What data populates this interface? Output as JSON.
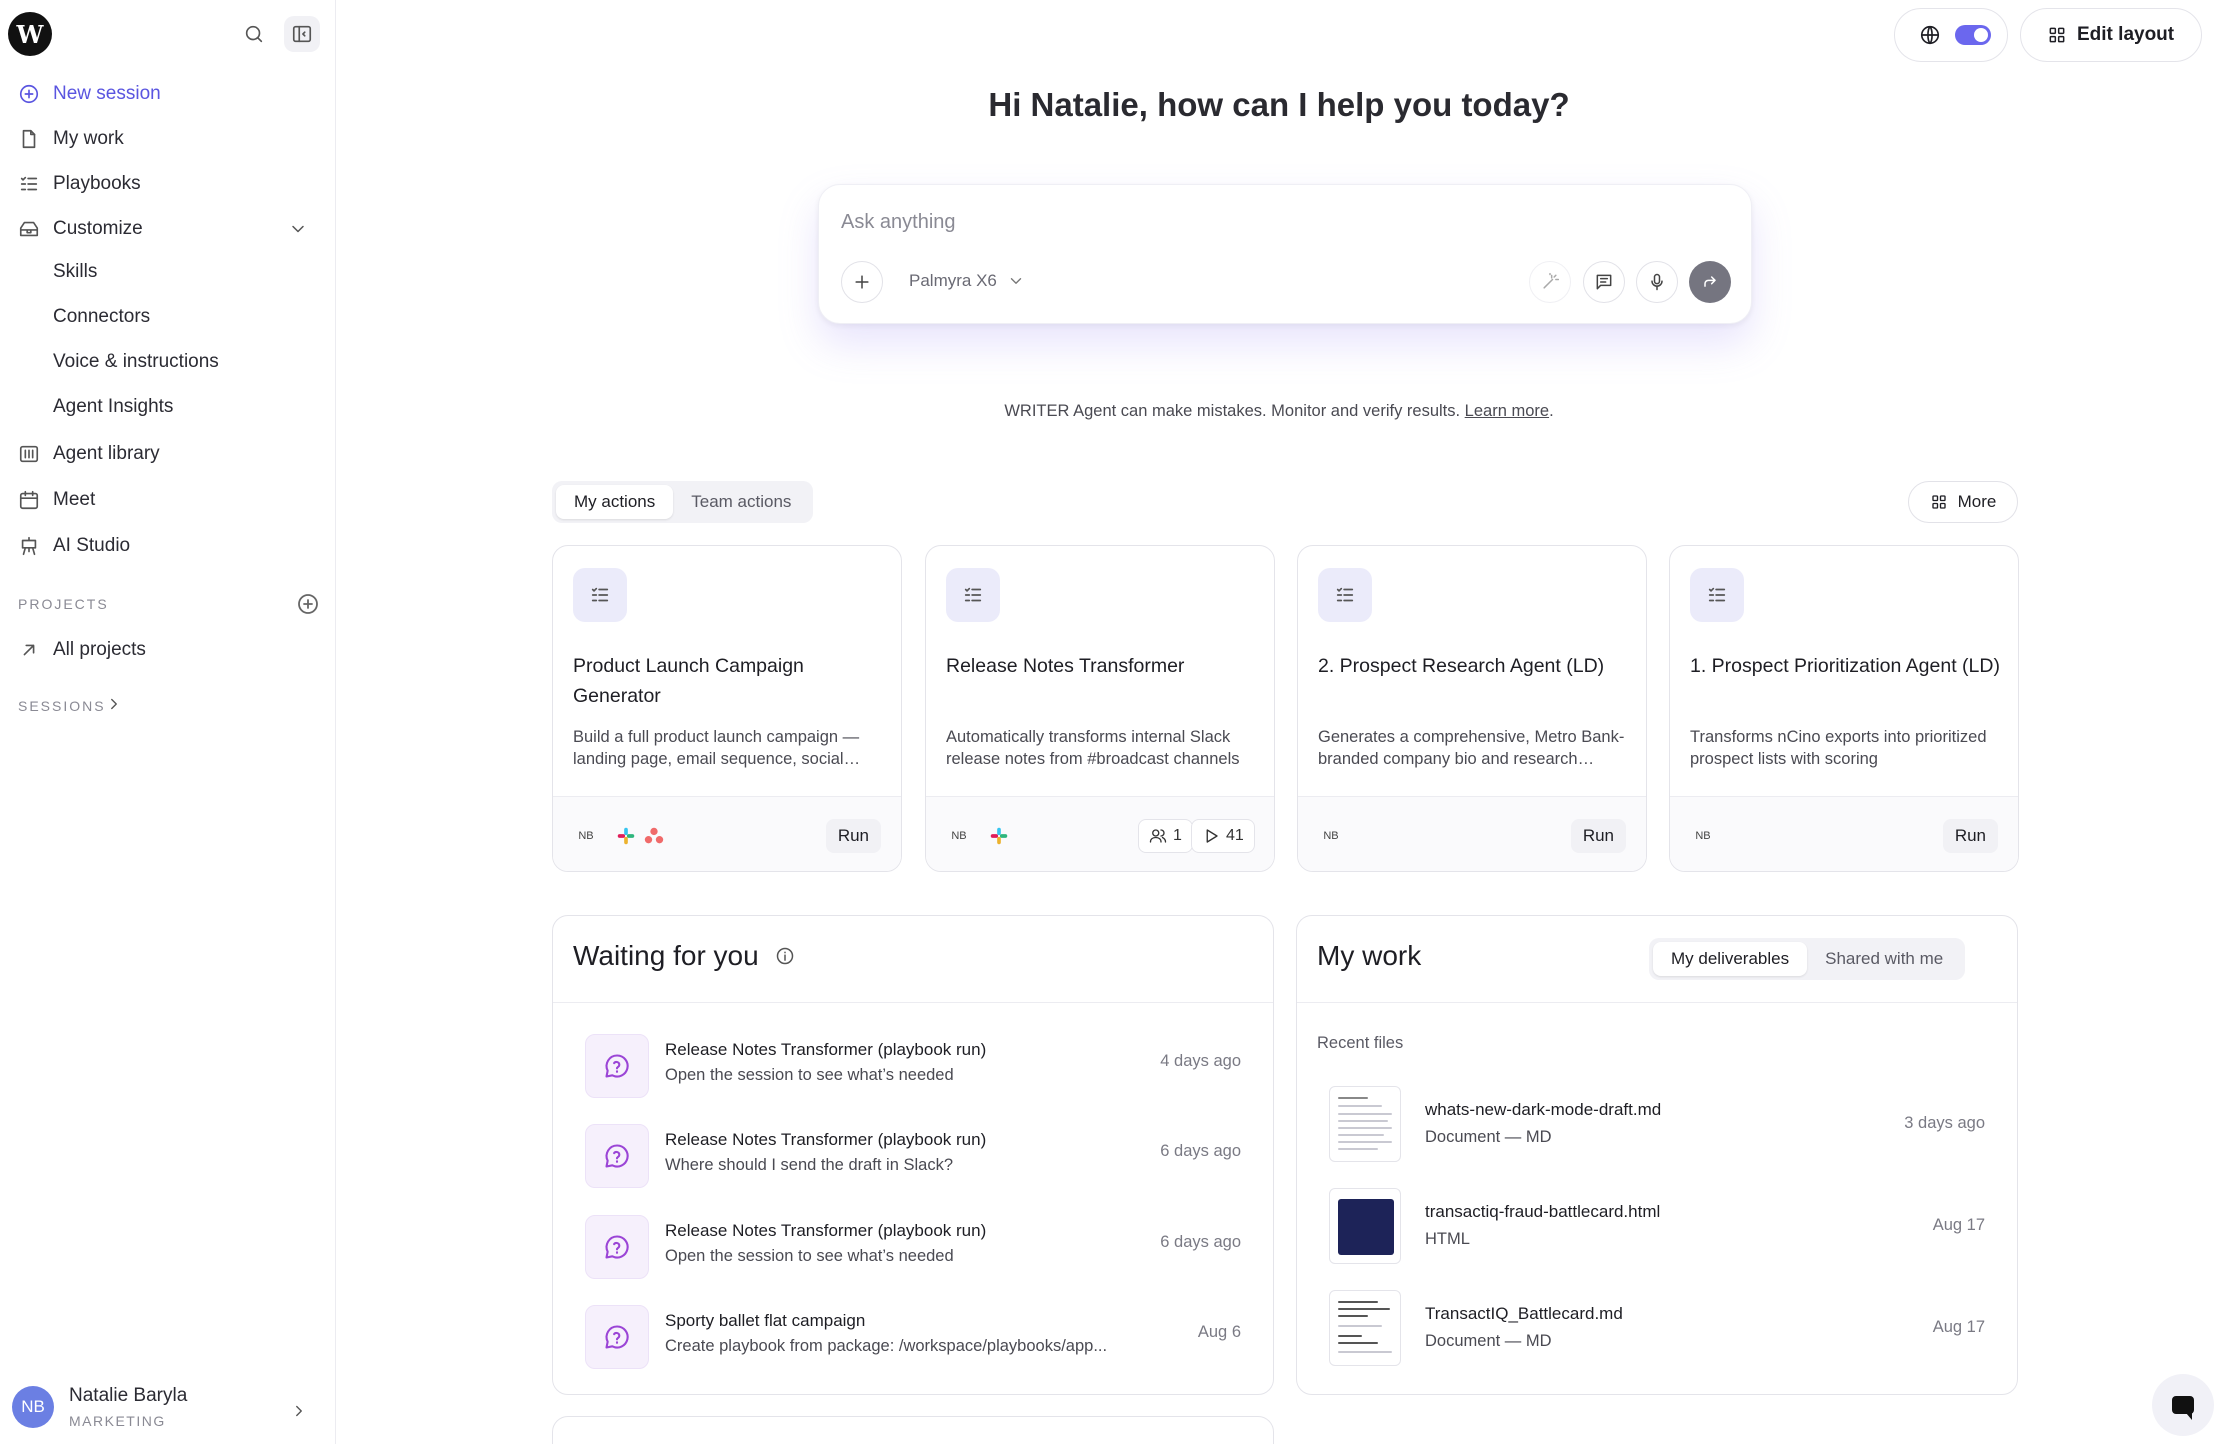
{
  "sidebar": {
    "logo_letter": "W",
    "items": {
      "new_session": "New session",
      "my_work": "My work",
      "playbooks": "Playbooks",
      "customize": "Customize",
      "skills": "Skills",
      "connectors": "Connectors",
      "voice": "Voice & instructions",
      "insights": "Agent Insights",
      "library": "Agent library",
      "meet": "Meet",
      "studio": "AI Studio"
    },
    "projects_label": "PROJECTS",
    "all_projects": "All projects",
    "sessions_label": "SESSIONS",
    "user": {
      "initials": "NB",
      "name": "Natalie Baryla",
      "team": "MARKETING"
    },
    "accent_color": "#5a55e0"
  },
  "header": {
    "edit_layout": "Edit layout"
  },
  "greeting": "Hi Natalie, how can I help you today?",
  "composer": {
    "placeholder": "Ask anything",
    "model": "Palmyra X6"
  },
  "disclaimer": {
    "text": "WRITER Agent can make mistakes. Monitor and verify results. ",
    "link": "Learn more",
    "end": "."
  },
  "actions": {
    "tabs": [
      "My actions",
      "Team actions"
    ],
    "more": "More",
    "cards": [
      {
        "title": "Product Launch Campaign Generator",
        "desc": "Build a full product launch campaign — landing page, email sequence, social posts",
        "owner": "NB",
        "run": "Run"
      },
      {
        "title": "Release Notes Transformer",
        "desc": "Automatically transforms internal Slack release notes from #broadcast channels",
        "owner": "NB",
        "users": "1",
        "runs": "41"
      },
      {
        "title": "2. Prospect Research Agent (LD)",
        "desc": "Generates a comprehensive, Metro Bank-branded company bio and research summary",
        "owner": "NB",
        "run": "Run"
      },
      {
        "title": "1. Prospect Prioritization Agent (LD)",
        "desc": "Transforms nCino exports into prioritized prospect lists with scoring",
        "owner": "NB",
        "run": "Run"
      }
    ]
  },
  "waiting": {
    "title": "Waiting for you",
    "items": [
      {
        "title": "Release Notes Transformer (playbook run)",
        "sub": "Open the session to see what’s needed",
        "time": "4 days ago"
      },
      {
        "title": "Release Notes Transformer (playbook run)",
        "sub": "Where should I send the draft in Slack?",
        "time": "6 days ago"
      },
      {
        "title": "Release Notes Transformer (playbook run)",
        "sub": "Open the session to see what’s needed",
        "time": "6 days ago"
      },
      {
        "title": "Sporty ballet flat campaign",
        "sub": "Create playbook from package: /workspace/playbooks/app...",
        "time": "Aug 6"
      }
    ]
  },
  "mywork": {
    "title": "My work",
    "tabs": [
      "My deliverables",
      "Shared with me"
    ],
    "recent_label": "Recent files",
    "files": [
      {
        "name": "whats-new-dark-mode-draft.md",
        "type": "Document — MD",
        "time": "3 days ago"
      },
      {
        "name": "transactiq-fraud-battlecard.html",
        "type": "HTML",
        "time": "Aug 17"
      },
      {
        "name": "TransactIQ_Battlecard.md",
        "type": "Document — MD",
        "time": "Aug 17"
      }
    ]
  }
}
